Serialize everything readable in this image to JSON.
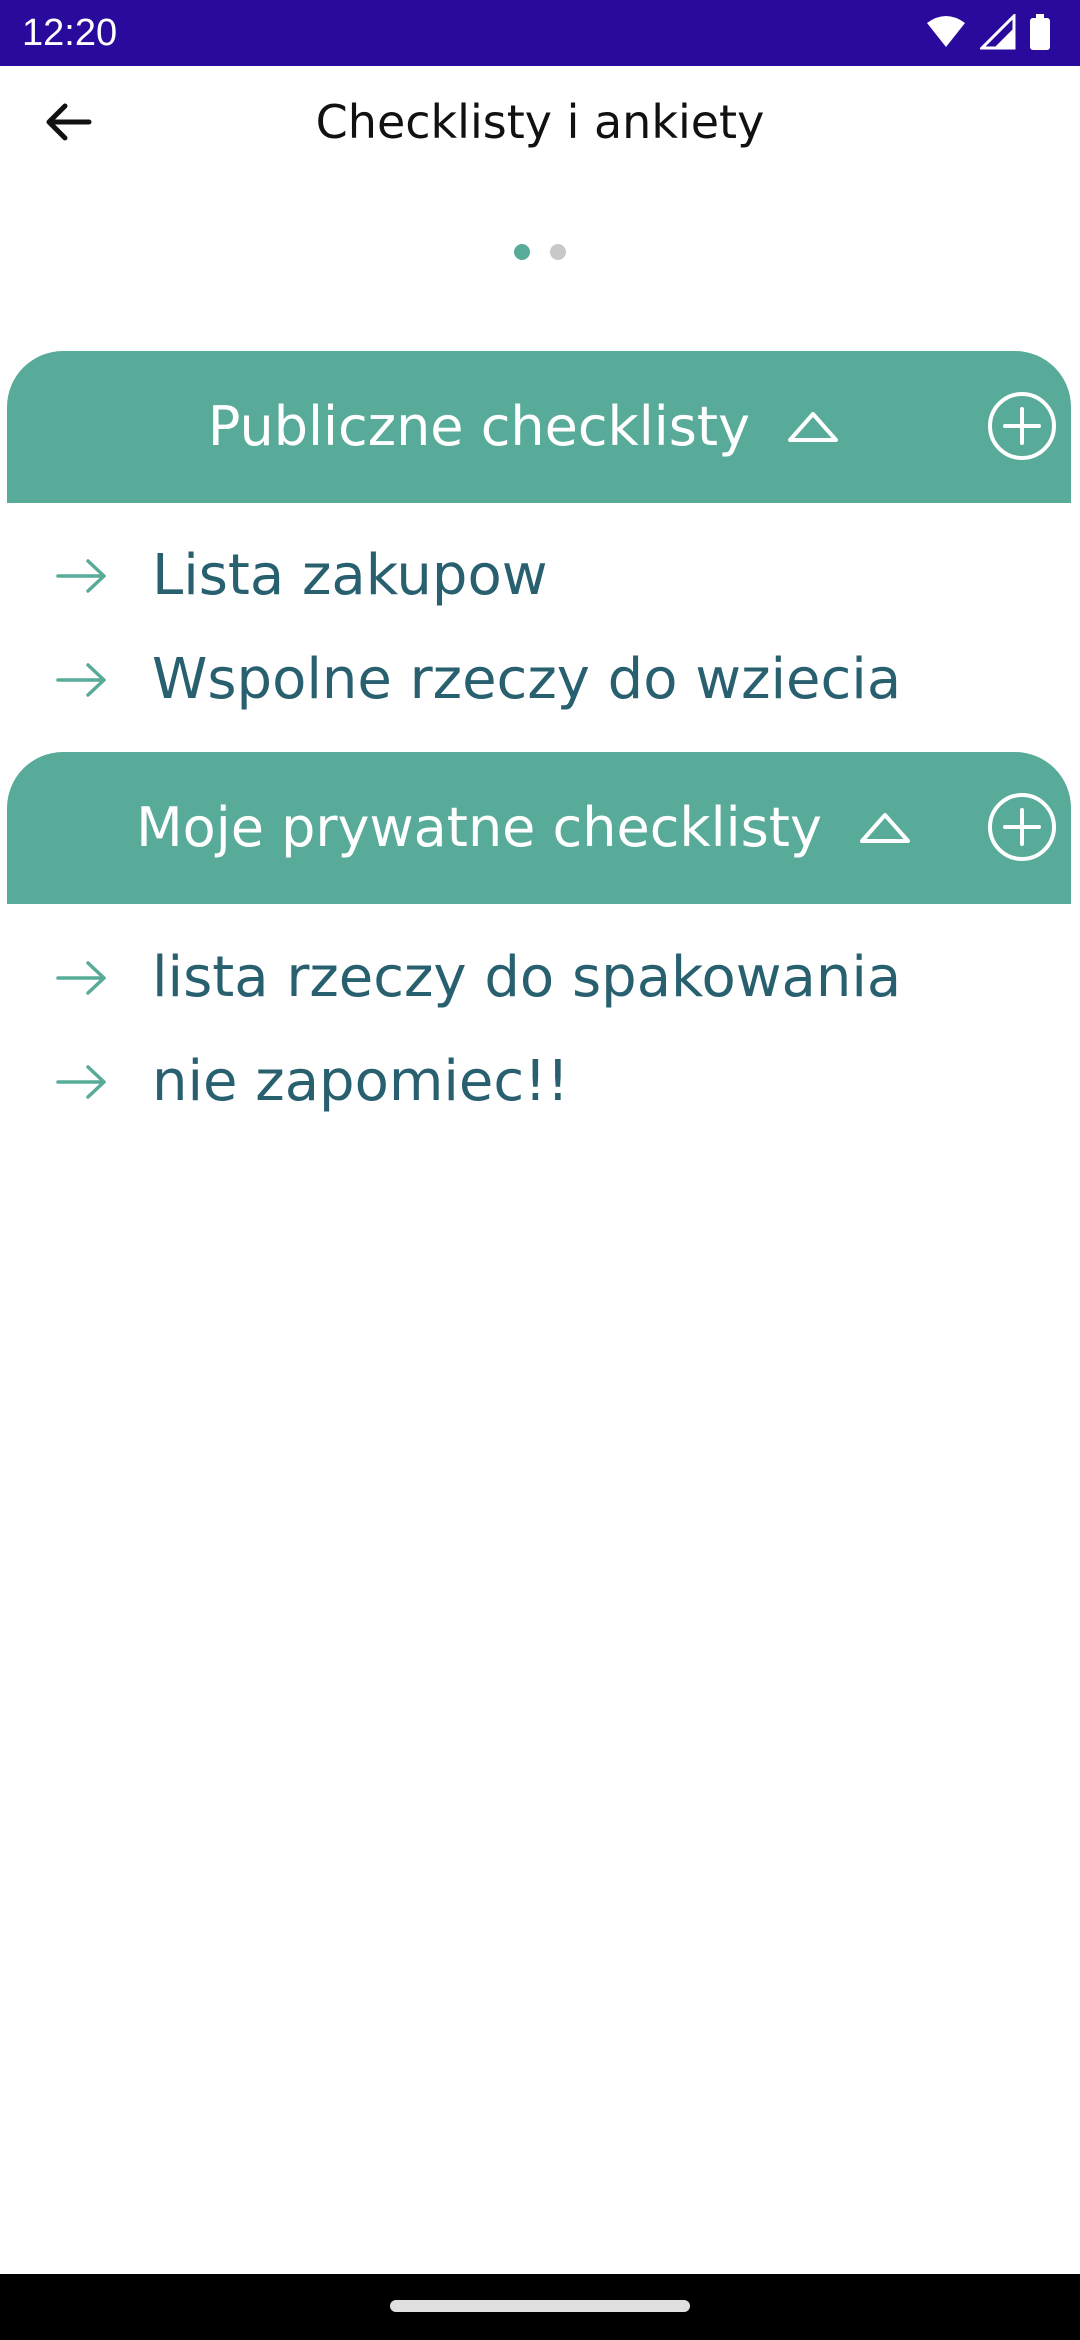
{
  "status_bar": {
    "time": "12:20",
    "background": "#2a0a9c",
    "icons": [
      "wifi-icon",
      "cell-signal-icon",
      "battery-icon"
    ]
  },
  "app_bar": {
    "title": "Checklisty i ankiety",
    "back_icon": "arrow-left-icon"
  },
  "pager": {
    "pages": 2,
    "active_index": 0,
    "active_color": "#58ab98",
    "inactive_color": "#c8c8c8"
  },
  "sections": [
    {
      "title": "Publiczne checklisty",
      "expanded": true,
      "items": [
        {
          "label": "Lista zakupow"
        },
        {
          "label": "Wspolne rzeczy do wziecia"
        }
      ]
    },
    {
      "title": "Moje prywatne checklisty",
      "expanded": true,
      "items": [
        {
          "label": "lista rzeczy do spakowania"
        },
        {
          "label": "nie zapomiec!!"
        }
      ]
    }
  ],
  "colors": {
    "accent": "#58ab98",
    "item_text": "#28606f",
    "header_text": "#ffffff"
  }
}
